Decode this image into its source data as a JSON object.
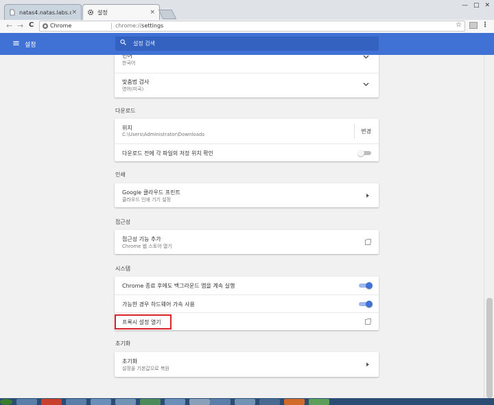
{
  "tabs": [
    {
      "label": "natas4.natas.labs.overthe",
      "close": "×"
    },
    {
      "label": "설정",
      "close": "×"
    }
  ],
  "window_buttons": [
    "—",
    "□",
    "✕"
  ],
  "toolbar": {
    "back_icon": "←",
    "forward_icon": "→",
    "reload_icon": "C",
    "site_chip": "Chrome",
    "url_scheme": "chrome://",
    "url_path": "settings",
    "star_icon": "☆",
    "menu_icon": "⋮"
  },
  "header": {
    "menu_icon": "≡",
    "title": "설정",
    "search_placeholder": "설정 검색"
  },
  "language_card": {
    "row1_label": "언어",
    "row1_value": "한국어",
    "row2_label": "맞춤법 검사",
    "row2_value": "영어(미국)"
  },
  "downloads": {
    "section_title": "다운로드",
    "location_label": "위치",
    "location_value": "C:\\Users\\Administrator\\Downloads",
    "change_button": "변경",
    "ask_label": "다운로드 전에 각 파일의 저장 위치 확인",
    "ask_enabled": false
  },
  "printing": {
    "section_title": "인쇄",
    "cloud_print_label": "Google 클라우드 프린트",
    "cloud_print_sub": "클라우드 인쇄 기기 설정"
  },
  "accessibility": {
    "section_title": "접근성",
    "add_label": "접근성 기능 추가",
    "add_sub": "Chrome 웹 스토어 열기"
  },
  "system": {
    "section_title": "시스템",
    "background_apps_label": "Chrome 종료 후에도 백그라운드 앱을 계속 실행",
    "background_apps_enabled": true,
    "hw_accel_label": "가능한 경우 하드웨어 가속 사용",
    "hw_accel_enabled": true,
    "proxy_label": "프록시 설정 열기"
  },
  "reset": {
    "section_title": "초기화",
    "reset_label": "초기화",
    "reset_sub": "설정을 기본값으로 복원"
  },
  "colors": {
    "accent": "#3f72d4",
    "highlight_box": "#d9242b"
  }
}
